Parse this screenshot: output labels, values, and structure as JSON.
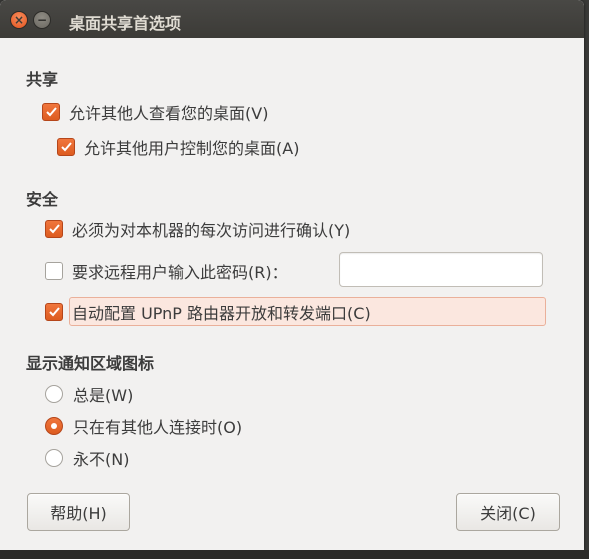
{
  "window": {
    "title": "桌面共享首选项",
    "close_glyph": "×",
    "minimize_glyph": "−"
  },
  "sharing": {
    "heading": "共享",
    "allow_view": {
      "label": "允许其他人查看您的桌面(V)",
      "checked": true
    },
    "allow_control": {
      "label": "允许其他用户控制您的桌面(A)",
      "checked": true
    }
  },
  "security": {
    "heading": "安全",
    "confirm_access": {
      "label": "必须为对本机器的每次访问进行确认(Y)",
      "checked": true
    },
    "require_password": {
      "label": "要求远程用户输入此密码(R)：",
      "checked": false
    },
    "password_value": "",
    "upnp": {
      "label": "自动配置 UPnP 路由器开放和转发端口(C)",
      "checked": true
    }
  },
  "notification": {
    "heading": "显示通知区域图标",
    "options": [
      {
        "label": "总是(W)",
        "selected": false
      },
      {
        "label": "只在有其他人连接时(O)",
        "selected": true
      },
      {
        "label": "永不(N)",
        "selected": false
      }
    ]
  },
  "buttons": {
    "help": "帮助(H)",
    "close": "关闭(C)"
  },
  "colors": {
    "accent": "#dd5c20",
    "titlebar": "#3c3b37",
    "background": "#f2f1f0"
  }
}
